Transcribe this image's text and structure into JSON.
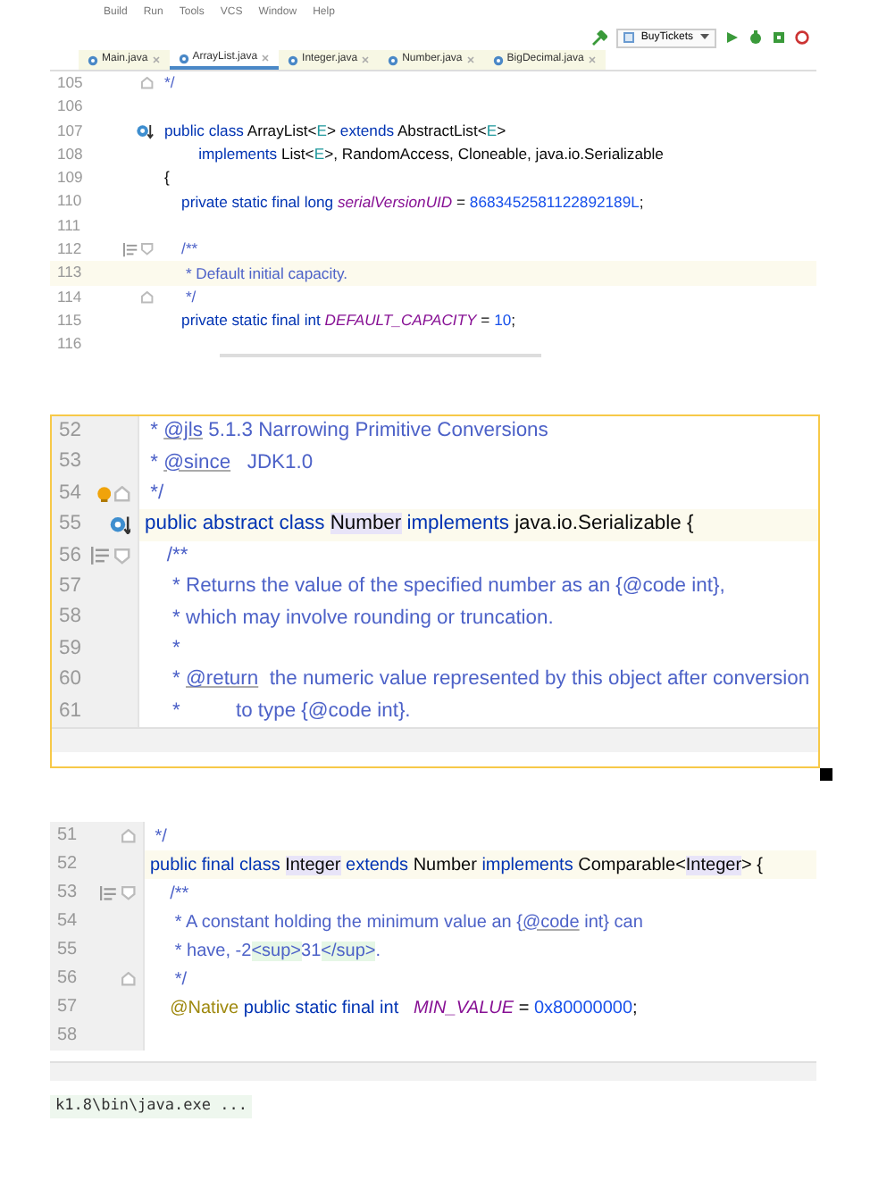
{
  "panels": [
    {
      "menu": [
        "Build",
        "Run",
        "Tools",
        "VCS",
        "Window",
        "Help"
      ],
      "run_config": "BuyTickets",
      "tabs": [
        {
          "label": "Main.java",
          "selected": false
        },
        {
          "label": "ArrayList.java",
          "selected": true
        },
        {
          "label": "Integer.java",
          "selected": false
        },
        {
          "label": "Number.java",
          "selected": false
        },
        {
          "label": "BigDecimal.java",
          "selected": false
        }
      ],
      "lines": [
        {
          "number": "105",
          "gutter": [
            {
              "kind": "fold-end"
            }
          ],
          "highlighted": false,
          "tokens": [
            {
              "text": "*/",
              "kind": "comment"
            }
          ]
        },
        {
          "number": "106",
          "highlighted": false
        },
        {
          "number": "107",
          "gutter": [
            {
              "kind": "implemented"
            }
          ],
          "highlighted": false,
          "tokens": [
            {
              "text": "public class ",
              "kind": "kw"
            },
            {
              "text": "ArrayList<",
              "kind": "plain"
            },
            {
              "text": "E",
              "kind": "tparam"
            },
            {
              "text": "> ",
              "kind": "plain"
            },
            {
              "text": "extends ",
              "kind": "kw"
            },
            {
              "text": "AbstractList<",
              "kind": "plain"
            },
            {
              "text": "E",
              "kind": "tparam"
            },
            {
              "text": ">",
              "kind": "plain"
            }
          ]
        },
        {
          "number": "108",
          "highlighted": false,
          "tokens": [
            {
              "text": "        implements ",
              "kind": "kw"
            },
            {
              "text": "List<",
              "kind": "plain"
            },
            {
              "text": "E",
              "kind": "tparam"
            },
            {
              "text": ">, RandomAccess, Cloneable, java.io.Serializable",
              "kind": "plain"
            }
          ]
        },
        {
          "number": "109",
          "highlighted": false,
          "tokens": [
            {
              "text": "{",
              "kind": "plain"
            }
          ]
        },
        {
          "number": "110",
          "highlighted": false,
          "tokens": [
            {
              "text": "    private static final long ",
              "kind": "kw"
            },
            {
              "text": "serialVersionUID",
              "kind": "field"
            },
            {
              "text": " = ",
              "kind": "plain"
            },
            {
              "text": "8683452581122892189L",
              "kind": "num"
            },
            {
              "text": ";",
              "kind": "plain"
            }
          ]
        },
        {
          "number": "111",
          "highlighted": false
        },
        {
          "number": "112",
          "gutter": [
            {
              "kind": "doc"
            },
            {
              "kind": "fold-start"
            }
          ],
          "highlighted": false,
          "tokens": [
            {
              "text": "    /**",
              "kind": "comment"
            }
          ]
        },
        {
          "number": "113",
          "highlighted": true,
          "tokens": [
            {
              "text": "     * Default initial capacity.",
              "kind": "comment"
            }
          ]
        },
        {
          "number": "114",
          "gutter": [
            {
              "kind": "fold-end"
            }
          ],
          "highlighted": false,
          "tokens": [
            {
              "text": "     */",
              "kind": "comment"
            }
          ]
        },
        {
          "number": "115",
          "highlighted": false,
          "tokens": [
            {
              "text": "    private static final int ",
              "kind": "kw"
            },
            {
              "text": "DEFAULT_CAPACITY",
              "kind": "field"
            },
            {
              "text": " = ",
              "kind": "plain"
            },
            {
              "text": "10",
              "kind": "num"
            },
            {
              "text": ";",
              "kind": "plain"
            }
          ]
        },
        {
          "number": "116",
          "highlighted": false
        }
      ]
    },
    {
      "lines": [
        {
          "number": "52",
          "highlighted": false,
          "tokens": [
            {
              "text": " * ",
              "kind": "comment"
            },
            {
              "text": "@jls",
              "kind": "tag"
            },
            {
              "text": " 5.1.3 Narrowing Primitive Conversions",
              "kind": "comment"
            }
          ]
        },
        {
          "number": "53",
          "highlighted": false,
          "tokens": [
            {
              "text": " * ",
              "kind": "comment"
            },
            {
              "text": "@since",
              "kind": "tag"
            },
            {
              "text": "   JDK1.0",
              "kind": "comment"
            }
          ]
        },
        {
          "number": "54",
          "gutter": [
            {
              "kind": "bulb"
            },
            {
              "kind": "fold-end"
            }
          ],
          "highlighted": false,
          "tokens": [
            {
              "text": " */",
              "kind": "comment"
            }
          ]
        },
        {
          "number": "55",
          "gutter": [
            {
              "kind": "implemented"
            }
          ],
          "highlighted": true,
          "tokens": [
            {
              "text": "public abstract class ",
              "kind": "kw"
            },
            {
              "text": "Number",
              "kind": "hl"
            },
            {
              "text": " implements ",
              "kind": "kw"
            },
            {
              "text": "java.io.Serializable {",
              "kind": "plain"
            }
          ]
        },
        {
          "number": "56",
          "gutter": [
            {
              "kind": "doc"
            },
            {
              "kind": "fold-start"
            }
          ],
          "highlighted": false,
          "tokens": [
            {
              "text": "    /**",
              "kind": "comment"
            }
          ]
        },
        {
          "number": "57",
          "highlighted": false,
          "tokens": [
            {
              "text": "     * Returns the value of the specified number as an {@code int},",
              "kind": "comment"
            }
          ]
        },
        {
          "number": "58",
          "highlighted": false,
          "tokens": [
            {
              "text": "     * which may involve rounding or truncation.",
              "kind": "comment"
            }
          ]
        },
        {
          "number": "59",
          "highlighted": false,
          "tokens": [
            {
              "text": "     *",
              "kind": "comment"
            }
          ]
        },
        {
          "number": "60",
          "highlighted": false,
          "tokens": [
            {
              "text": "     * ",
              "kind": "comment"
            },
            {
              "text": "@return",
              "kind": "tag"
            },
            {
              "text": "  the numeric value represented by this object after conversion",
              "kind": "comment"
            }
          ]
        },
        {
          "number": "61",
          "highlighted": false,
          "tokens": [
            {
              "text": "     *          to type {@code int}.",
              "kind": "comment"
            }
          ]
        }
      ]
    },
    {
      "console": "k1.8\\bin\\java.exe ...",
      "lines": [
        {
          "number": "51",
          "gutter": [
            {
              "kind": "fold-end"
            }
          ],
          "highlighted": false,
          "tokens": [
            {
              "text": " */",
              "kind": "comment"
            }
          ]
        },
        {
          "number": "52",
          "highlighted": true,
          "tokens": [
            {
              "text": "public final class ",
              "kind": "kw"
            },
            {
              "text": "Integer",
              "kind": "hl"
            },
            {
              "text": " extends ",
              "kind": "kw"
            },
            {
              "text": "Number ",
              "kind": "plain"
            },
            {
              "text": "implements ",
              "kind": "kw"
            },
            {
              "text": "Comparable<",
              "kind": "plain"
            },
            {
              "text": "Integer",
              "kind": "hl"
            },
            {
              "text": "> {",
              "kind": "plain"
            }
          ]
        },
        {
          "number": "53",
          "gutter": [
            {
              "kind": "doc"
            },
            {
              "kind": "fold-start"
            }
          ],
          "highlighted": false,
          "tokens": [
            {
              "text": "    /**",
              "kind": "comment"
            }
          ]
        },
        {
          "number": "54",
          "highlighted": false,
          "tokens": [
            {
              "text": "     * A constant holding the minimum value an {",
              "kind": "comment"
            },
            {
              "text": "@code",
              "kind": "tag"
            },
            {
              "text": " int} can",
              "kind": "comment"
            }
          ]
        },
        {
          "number": "55",
          "highlighted": false,
          "tokens": [
            {
              "text": "     * have, -2",
              "kind": "comment"
            },
            {
              "text": "<sup>",
              "kind": "html"
            },
            {
              "text": "31",
              "kind": "comment"
            },
            {
              "text": "</sup>",
              "kind": "html"
            },
            {
              "text": ".",
              "kind": "comment"
            }
          ]
        },
        {
          "number": "56",
          "gutter": [
            {
              "kind": "fold-end"
            }
          ],
          "highlighted": false,
          "tokens": [
            {
              "text": "     */",
              "kind": "comment"
            }
          ]
        },
        {
          "number": "57",
          "highlighted": false,
          "tokens": [
            {
              "text": "    @Native ",
              "kind": "annot"
            },
            {
              "text": "public static final int   ",
              "kind": "kw"
            },
            {
              "text": "MIN_VALUE",
              "kind": "field"
            },
            {
              "text": " = ",
              "kind": "plain"
            },
            {
              "text": "0x80000000",
              "kind": "num"
            },
            {
              "text": ";",
              "kind": "plain"
            }
          ]
        },
        {
          "number": "58",
          "highlighted": false
        }
      ]
    }
  ]
}
